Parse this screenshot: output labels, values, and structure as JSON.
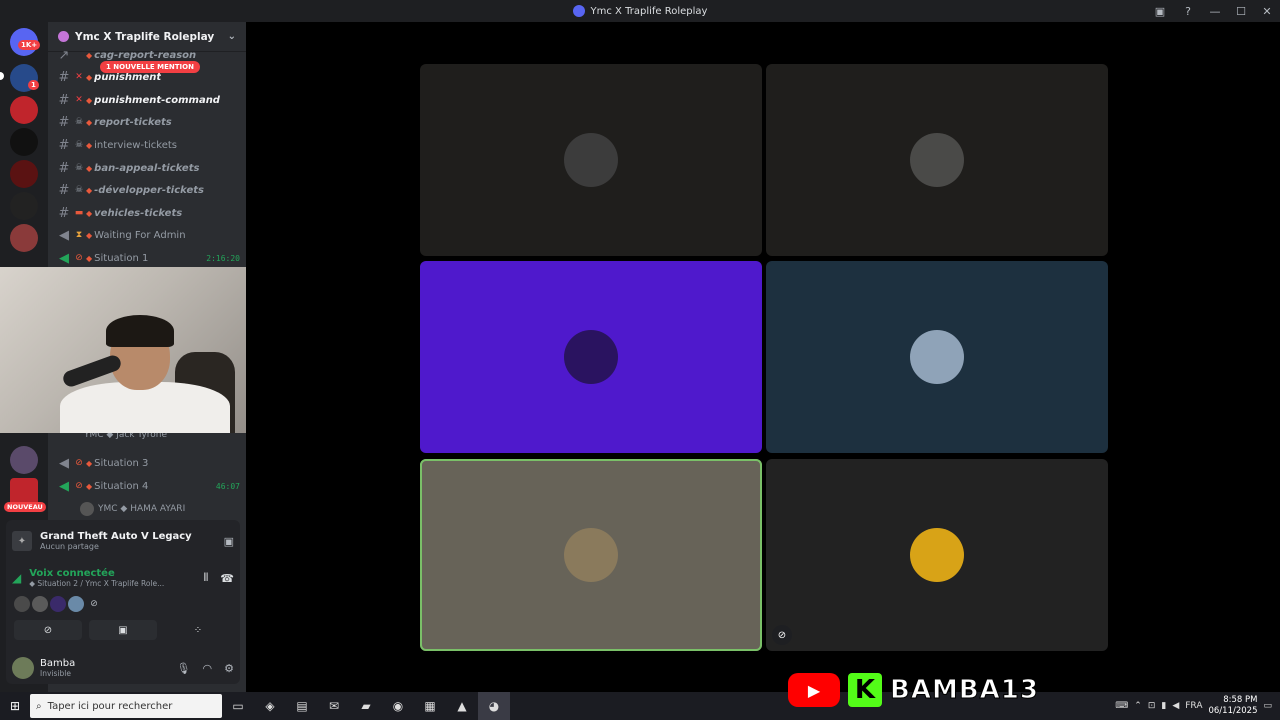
{
  "window": {
    "title": "Ymc X Traplife Roleplay"
  },
  "rail": {
    "top_badge": "1K+",
    "mention_badge": "1",
    "new_badge": "NOUVEAU"
  },
  "server": {
    "name": "Ymc X Traplife Roleplay"
  },
  "mention_banner": "1 NOUVELLE MENTION",
  "channels": [
    {
      "label": "cag-report-reason",
      "type": "text"
    },
    {
      "label": "punishment",
      "type": "text"
    },
    {
      "label": "punishment-command",
      "type": "text"
    },
    {
      "label": "report-tickets",
      "type": "text"
    },
    {
      "label": "interview-tickets",
      "type": "text"
    },
    {
      "label": "ban-appeal-tickets",
      "type": "text"
    },
    {
      "label": "-développer-tickets",
      "type": "text"
    },
    {
      "label": "vehicles-tickets",
      "type": "text"
    },
    {
      "label": "Waiting For Admin",
      "type": "voice"
    },
    {
      "label": "Situation 1",
      "type": "voice",
      "timer": "2:16:20"
    },
    {
      "label": "Situation 3",
      "type": "voice"
    },
    {
      "label": "Situation 4",
      "type": "voice",
      "timer": "46:07"
    }
  ],
  "voice_users": [
    {
      "name": "YMC ◆ Jack Tyrone"
    },
    {
      "name": "YMC ◆ HAMA AYARI"
    }
  ],
  "panel": {
    "game_name": "Grand Theft Auto V Legacy",
    "game_sub": "Aucun partage",
    "voice_label": "Voix connectée",
    "voice_sub": "◆ Situation 2 / Ymc X Traplife Role..."
  },
  "user": {
    "name": "Bamba",
    "status": "Invisible"
  },
  "tiles": [
    {
      "bg": "#1f1e1c",
      "avatar": "#3c3c3c"
    },
    {
      "bg": "#1f1e1c",
      "avatar": "#4a4a48"
    },
    {
      "bg": "#4f19cc",
      "avatar": "#2a1360"
    },
    {
      "bg": "#1d303f",
      "avatar": "#8fa3b8"
    },
    {
      "bg": "#676358",
      "avatar": "#8a7a5c",
      "speaking": true
    },
    {
      "bg": "#222222",
      "avatar": "#d8a317",
      "muted": true
    }
  ],
  "brand": {
    "name": "BAMBA13"
  },
  "taskbar": {
    "search_placeholder": "Taper ici pour rechercher",
    "lang": "FRA",
    "time": "8:58 PM",
    "date": "06/11/2025"
  },
  "colors": {
    "accent_green": "#23a55a",
    "mention_red": "#f23f43",
    "speaking_outline": "#7ac068"
  }
}
